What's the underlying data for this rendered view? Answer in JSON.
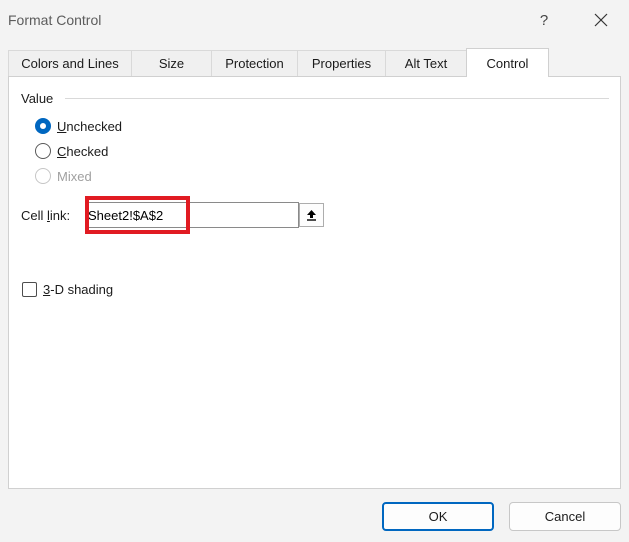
{
  "window": {
    "title": "Format Control",
    "help_glyph": "?",
    "close_icon": "close-icon"
  },
  "tabs": [
    {
      "label": "Colors and Lines",
      "active": false
    },
    {
      "label": "Size",
      "active": false
    },
    {
      "label": "Protection",
      "active": false
    },
    {
      "label": "Properties",
      "active": false
    },
    {
      "label": "Alt Text",
      "active": false
    },
    {
      "label": "Control",
      "active": true
    }
  ],
  "value_group": {
    "label": "Value",
    "options": [
      {
        "accel": "U",
        "rest": "nchecked",
        "checked": true,
        "enabled": true
      },
      {
        "accel": "C",
        "rest": "hecked",
        "checked": false,
        "enabled": true
      },
      {
        "accel": "",
        "rest": "Mixed",
        "checked": false,
        "enabled": false
      }
    ]
  },
  "cell_link": {
    "label_pre": "Cell ",
    "label_accel": "l",
    "label_post": "ink:",
    "value": "Sheet2!$A$2",
    "collapse_icon": "collapse-dialog-icon",
    "highlight_color": "#e11b22"
  },
  "shading": {
    "accel": "3",
    "rest": "-D shading",
    "checked": false
  },
  "buttons": {
    "ok": "OK",
    "cancel": "Cancel"
  },
  "colors": {
    "accent": "#0067c0"
  }
}
